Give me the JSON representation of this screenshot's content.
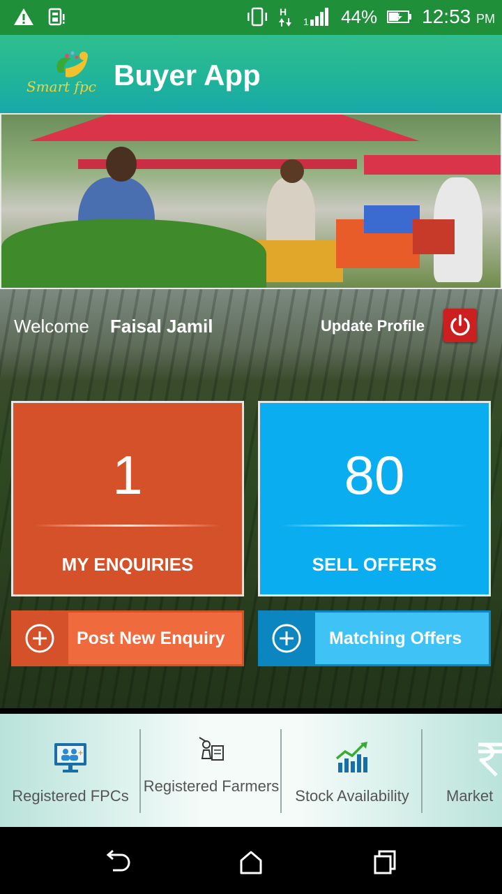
{
  "status_bar": {
    "battery": "44%",
    "time": "12:53",
    "ampm": "PM"
  },
  "app_bar": {
    "logo_text": "Smart fpc",
    "title": "Buyer App"
  },
  "welcome": {
    "label": "Welcome",
    "name": "Faisal Jamil",
    "update_profile": "Update Profile"
  },
  "cards": {
    "enquiries": {
      "count": "1",
      "label": "MY ENQUIRIES",
      "color": "#d4512a"
    },
    "sell_offers": {
      "count": "80",
      "label": "SELL OFFERS",
      "color": "#0aaef0"
    }
  },
  "actions": {
    "post_enquiry": "Post New Enquiry",
    "matching_offers": "Matching Offers"
  },
  "bottom_menu": [
    {
      "label": "Registered FPCs",
      "icon": "registered-fpcs-icon"
    },
    {
      "label": "Registered Farmers",
      "icon": "registered-farmers-icon"
    },
    {
      "label": "Stock Availability",
      "icon": "stock-availability-icon"
    },
    {
      "label": "Market",
      "icon": "rupee-icon"
    }
  ]
}
